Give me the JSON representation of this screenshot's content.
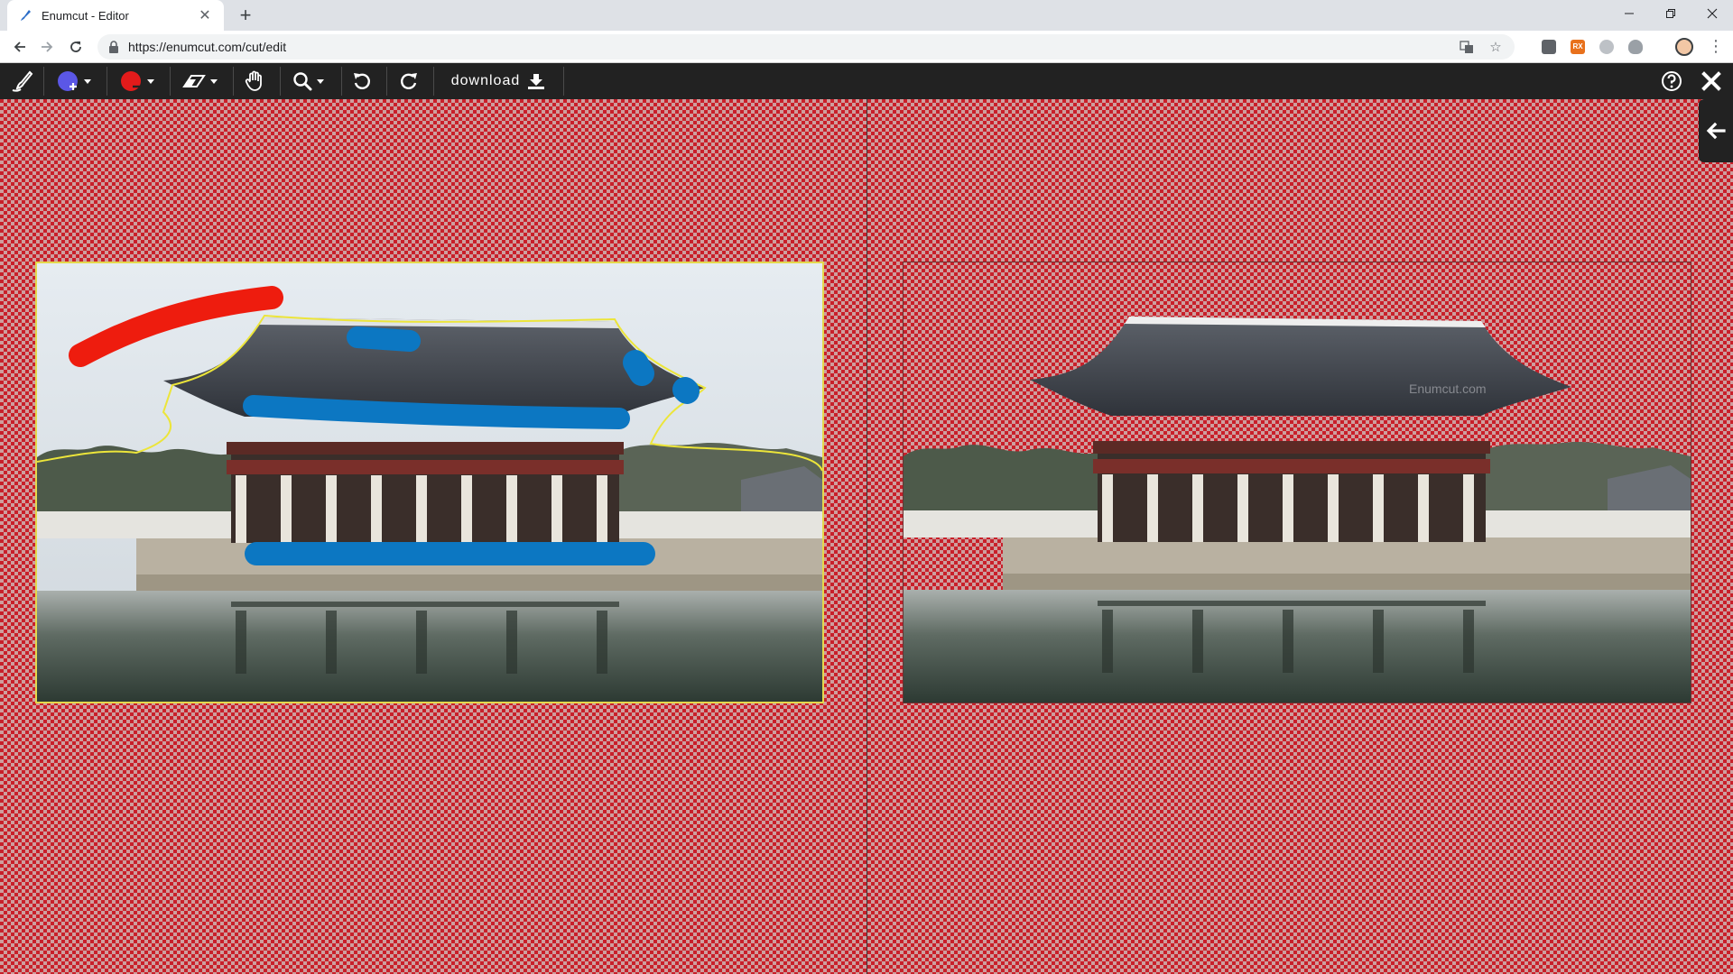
{
  "browser": {
    "tab": {
      "title": "Enumcut - Editor",
      "favicon": "enumcut-brush-icon"
    },
    "new_tab_label": "+",
    "url": "https://enumcut.com/cut/edit",
    "extensions": [
      "extension-dark-icon",
      "extension-orange-icon",
      "extension-circle-icon",
      "extension-shield-icon"
    ],
    "extension_badge": "RX"
  },
  "toolbar": {
    "items": [
      {
        "name": "brush-tool",
        "icon": "brush-icon"
      },
      {
        "name": "foreground-marker",
        "icon": "plus-circle-icon",
        "color": "#5b57e6"
      },
      {
        "name": "background-marker",
        "icon": "minus-circle-icon",
        "color": "#e31b1b"
      },
      {
        "name": "eraser-tool",
        "icon": "eraser-icon"
      },
      {
        "name": "pan-tool",
        "icon": "hand-icon"
      },
      {
        "name": "zoom-tool",
        "icon": "magnifier-icon"
      },
      {
        "name": "undo",
        "icon": "undo-icon"
      },
      {
        "name": "redo",
        "icon": "redo-icon"
      }
    ],
    "download_label": "download",
    "help_icon": "help-icon",
    "close_icon": "close-icon"
  },
  "colors": {
    "toolbar_bg": "#222222",
    "foreground_stroke": "#0c77c2",
    "background_stroke": "#ee1c0e",
    "selection_outline": "#e4d84c",
    "transparency_red": "#c8202a"
  },
  "panels": {
    "source": {
      "name": "source-image-with-markers"
    },
    "result": {
      "name": "cutout-result-preview",
      "watermark": "Enumcut.com"
    }
  },
  "side_panel_toggle": {
    "icon": "arrow-left-icon"
  }
}
